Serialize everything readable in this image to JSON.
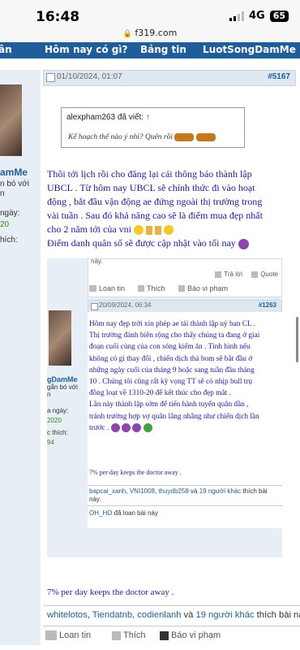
{
  "status": {
    "time": "16:48",
    "network": "4G",
    "battery": "65"
  },
  "browser": {
    "url": "f319.com",
    "lock_icon": "lock-icon"
  },
  "nav": {
    "items": [
      "ân",
      "Hôm nay có gì?",
      "Bảng tin",
      "LuotSongDamMe"
    ]
  },
  "post1": {
    "date": "01/10/2024, 01:07",
    "number": "#5167",
    "username": "amMe",
    "side_lines": [
      "n bó với",
      "n"
    ],
    "side_join_label": "ngày:",
    "side_join_value": "20",
    "side_likes_label": "hích:",
    "quote_author": "alexpham263 đã viết:",
    "quote_text": "Kế hoạch thế nào ý nhỉ? Quên rồi",
    "body_lines": [
      "Thôi tới lịch rồi cho đăng lại cái thông báo thành lập",
      "UBCL . Từ hôm nay UBCL sẽ chính thức đi vào hoạt",
      "động , bắt đầu vận động ae đứng ngoài thị trường trong",
      "vài tuần . Sau đó khả năng cao sẽ là điểm mua đẹp nhất",
      "cho 2 năm tới của vni",
      "Điểm danh quân số sẽ được cập nhật vào tối nay"
    ],
    "signature": "7% per day keeps the doctor away .",
    "likers": [
      "whitelotos",
      "Tiendatnb",
      "codienlanh"
    ],
    "likers_sep1": ", ",
    "likers_and": " và ",
    "likers_more": "19 người khác",
    "likers_suffix": " thích bài này.",
    "btn_loan": "Loan tin",
    "btn_like": "Thích",
    "btn_report": "Báo vi phạm"
  },
  "inner_post_top": {
    "cut_text": "này.",
    "reply": "Trả lời",
    "quote": "Quote",
    "loan": "Loan tin",
    "like": "Thích",
    "report": "Báo vi phạm"
  },
  "inner_post": {
    "date": "20/09/2024, 06:34",
    "number": "#1263",
    "username": "gDamMe",
    "side_lines": [
      "gắn bó với",
      "n"
    ],
    "side_join_label": "a ngày:",
    "side_join_value": "2020",
    "side_likes_label": "c thích:",
    "side_likes_value": "94",
    "body_lines": [
      "Hôm nay đẹp trời xin phép ae tái thành lập uỷ ban CL .",
      "Thị trường đánh biên rộng cho thấy chúng ta đang ở giai",
      "đoạn cuối cùng của con sóng kiếm ăn . Tình hình nếu",
      "không có gì thay đổi , chiến dịch thả bom sẽ bắt đầu ở",
      "những ngày cuối của tháng 9 hoặc sang tuần đầu tháng",
      "10 . Chúng tôi cũng rất kỳ vọng TT sẽ có nhịp bull trụ",
      "đồng loạt về 1310-20 để kết thúc cho đẹp mắt .",
      "Lần này thành lập sớm để tiến hành tuyển quân dần ,",
      "tránh trường hợp vợ quân lằng nhằng như chiến dịch lần",
      "trước ."
    ],
    "signature": "7% per day keeps the doctor away .",
    "likers": [
      "bapcai_xanh",
      "VNI1008",
      "thuydb258"
    ],
    "likers_sep": ", ",
    "likers_and": " và ",
    "likers_more": "19 người khác",
    "likers_suffix": " thích bài",
    "likers_cont": "này.",
    "loaned_user": "OH_HO",
    "loaned_text": " đã loan bài này"
  },
  "colors": {
    "nav": "#1f5d9b",
    "post_text": "#1a1aa0",
    "link": "#1f5d9b",
    "accent_red": "#b0171f",
    "green": "#3a8a1c"
  }
}
